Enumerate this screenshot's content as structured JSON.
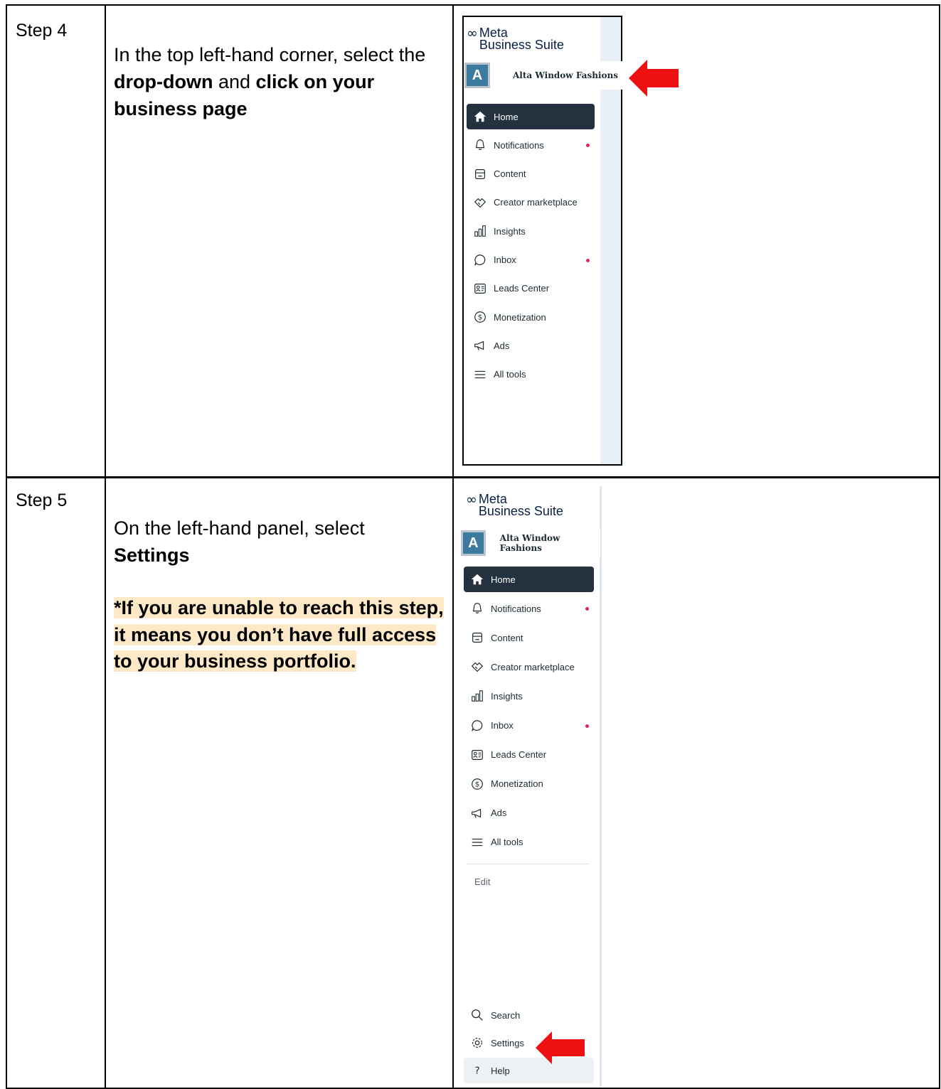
{
  "rows": [
    {
      "step": "Step 4",
      "instruction_parts": [
        {
          "text": "In the top left-hand corner, select the ",
          "bold": false
        },
        {
          "text": "drop-down",
          "bold": true
        },
        {
          "text": " and ",
          "bold": false
        },
        {
          "text": "click on your business page",
          "bold": true
        }
      ]
    },
    {
      "step": "Step 5",
      "instruction_parts": [
        {
          "text": "On the left-hand panel, select ",
          "bold": false
        },
        {
          "text": "Settings",
          "bold": true
        }
      ],
      "note": "*If you are unable to reach this step, it means you don’t have full access to your business portfolio."
    }
  ],
  "sidebar": {
    "brand_top": "Meta",
    "brand_bottom": "Business Suite",
    "account_initial": "A",
    "account_name": "Alta Window Fashions",
    "items": [
      {
        "label": "Home",
        "icon": "home-icon",
        "dot": false
      },
      {
        "label": "Notifications",
        "icon": "bell-icon",
        "dot": true
      },
      {
        "label": "Content",
        "icon": "content-icon",
        "dot": false
      },
      {
        "label": "Creator marketplace",
        "icon": "handshake-icon",
        "dot": false
      },
      {
        "label": "Insights",
        "icon": "bar-chart-icon",
        "dot": false
      },
      {
        "label": "Inbox",
        "icon": "chat-bubble-icon",
        "dot": true
      },
      {
        "label": "Leads Center",
        "icon": "contact-card-icon",
        "dot": false
      },
      {
        "label": "Monetization",
        "icon": "dollar-icon",
        "dot": false
      },
      {
        "label": "Ads",
        "icon": "megaphone-icon",
        "dot": false
      },
      {
        "label": "All tools",
        "icon": "menu-icon",
        "dot": false
      }
    ],
    "edit_label": "Edit",
    "bottom_items": [
      {
        "label": "Search",
        "icon": "search-icon"
      },
      {
        "label": "Settings",
        "icon": "gear-icon"
      },
      {
        "label": "Help",
        "icon": "help-icon"
      }
    ]
  },
  "colors": {
    "highlight": "#fde9c8",
    "arrow": "#ee1111",
    "active_nav": "#243240",
    "notification_dot": "#e0245e"
  }
}
